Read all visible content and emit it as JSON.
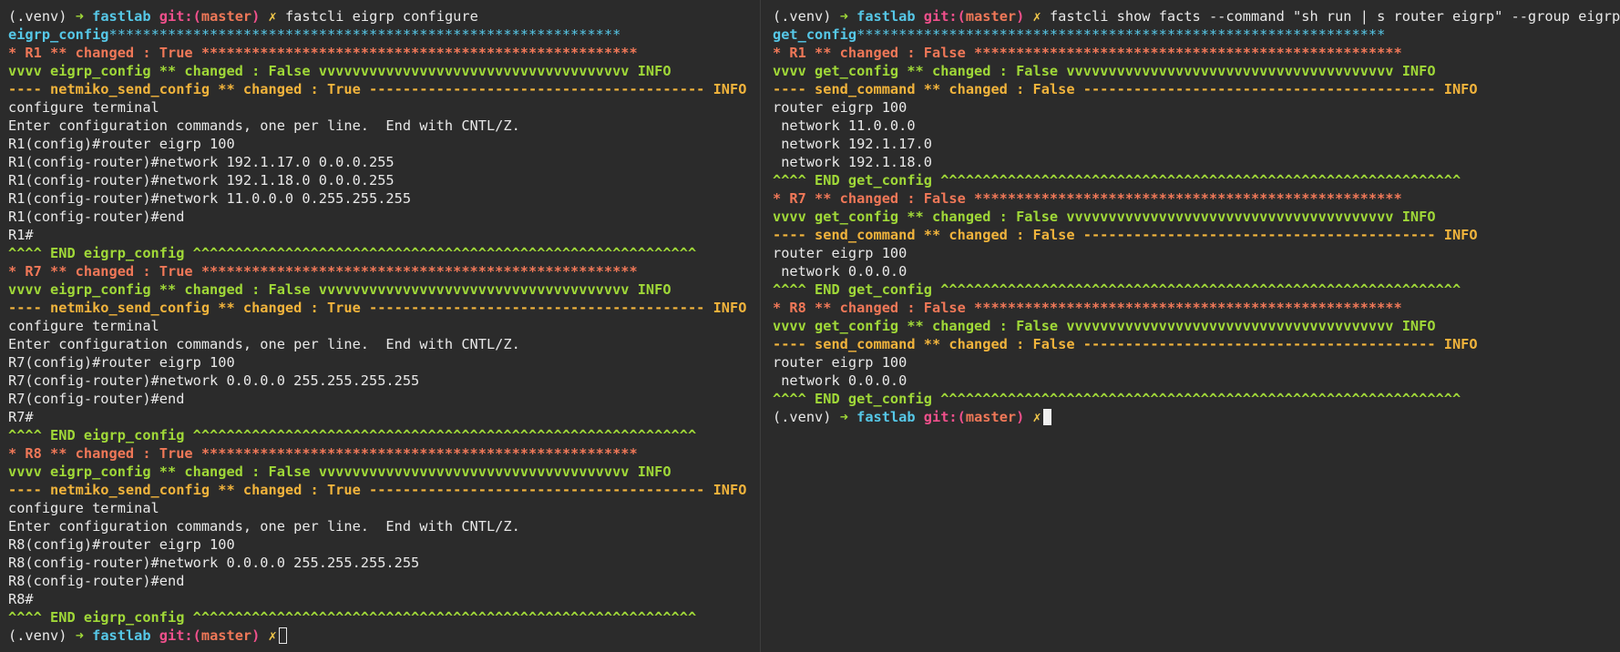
{
  "colors": {
    "background": "#2b2b2b",
    "text": "#e8e8e8",
    "cyan": "#56c8e8",
    "green": "#a0d838",
    "orange": "#f07858",
    "yellow": "#f2b43c",
    "pink": "#f0508c"
  },
  "panes": [
    {
      "name": "left-terminal",
      "lines": [
        [
          [
            "(.venv) ",
            "white"
          ],
          [
            "➜ ",
            "green"
          ],
          [
            "fastlab ",
            "cyan",
            "b"
          ],
          [
            "git:(",
            "pink",
            "b"
          ],
          [
            "master",
            "orange",
            "b"
          ],
          [
            ") ",
            "pink",
            "b"
          ],
          [
            "✗ ",
            "prompt-mark",
            "b"
          ],
          [
            "fastcli eigrp configure",
            "white"
          ]
        ],
        [
          [
            "eigrp_config",
            "cyan",
            "b"
          ],
          [
            "*************************************************************",
            "cyan"
          ]
        ],
        [
          [
            "* R1 ** changed : True ****************************************************",
            "orange",
            "b"
          ]
        ],
        [
          [
            "vvvv eigrp_config ** changed : False vvvvvvvvvvvvvvvvvvvvvvvvvvvvvvvvvvvvv INFO",
            "green",
            "b"
          ]
        ],
        [
          [
            "---- netmiko_send_config ** changed : True ---------------------------------------- INFO",
            "yellow",
            "b"
          ]
        ],
        [
          [
            "configure terminal",
            "white"
          ]
        ],
        [
          [
            "Enter configuration commands, one per line.  End with CNTL/Z.",
            "white"
          ]
        ],
        [
          [
            "R1(config)#router eigrp 100",
            "white"
          ]
        ],
        [
          [
            "R1(config-router)#network 192.1.17.0 0.0.0.255",
            "white"
          ]
        ],
        [
          [
            "R1(config-router)#network 192.1.18.0 0.0.0.255",
            "white"
          ]
        ],
        [
          [
            "R1(config-router)#network 11.0.0.0 0.255.255.255",
            "white"
          ]
        ],
        [
          [
            "R1(config-router)#end",
            "white"
          ]
        ],
        [
          [
            "R1#",
            "white"
          ]
        ],
        [
          [
            "^^^^ END eigrp_config ^^^^^^^^^^^^^^^^^^^^^^^^^^^^^^^^^^^^^^^^^^^^^^^^^^^^^^^^^^^^",
            "green",
            "b"
          ]
        ],
        [
          [
            "* R7 ** changed : True ****************************************************",
            "orange",
            "b"
          ]
        ],
        [
          [
            "vvvv eigrp_config ** changed : False vvvvvvvvvvvvvvvvvvvvvvvvvvvvvvvvvvvvv INFO",
            "green",
            "b"
          ]
        ],
        [
          [
            "---- netmiko_send_config ** changed : True ---------------------------------------- INFO",
            "yellow",
            "b"
          ]
        ],
        [
          [
            "configure terminal",
            "white"
          ]
        ],
        [
          [
            "Enter configuration commands, one per line.  End with CNTL/Z.",
            "white"
          ]
        ],
        [
          [
            "R7(config)#router eigrp 100",
            "white"
          ]
        ],
        [
          [
            "R7(config-router)#network 0.0.0.0 255.255.255.255",
            "white"
          ]
        ],
        [
          [
            "R7(config-router)#end",
            "white"
          ]
        ],
        [
          [
            "R7#",
            "white"
          ]
        ],
        [
          [
            "^^^^ END eigrp_config ^^^^^^^^^^^^^^^^^^^^^^^^^^^^^^^^^^^^^^^^^^^^^^^^^^^^^^^^^^^^",
            "green",
            "b"
          ]
        ],
        [
          [
            "* R8 ** changed : True ****************************************************",
            "orange",
            "b"
          ]
        ],
        [
          [
            "vvvv eigrp_config ** changed : False vvvvvvvvvvvvvvvvvvvvvvvvvvvvvvvvvvvvv INFO",
            "green",
            "b"
          ]
        ],
        [
          [
            "---- netmiko_send_config ** changed : True ---------------------------------------- INFO",
            "yellow",
            "b"
          ]
        ],
        [
          [
            "configure terminal",
            "white"
          ]
        ],
        [
          [
            "Enter configuration commands, one per line.  End with CNTL/Z.",
            "white"
          ]
        ],
        [
          [
            "R8(config)#router eigrp 100",
            "white"
          ]
        ],
        [
          [
            "R8(config-router)#network 0.0.0.0 255.255.255.255",
            "white"
          ]
        ],
        [
          [
            "R8(config-router)#end",
            "white"
          ]
        ],
        [
          [
            "R8#",
            "white"
          ]
        ],
        [
          [
            "^^^^ END eigrp_config ^^^^^^^^^^^^^^^^^^^^^^^^^^^^^^^^^^^^^^^^^^^^^^^^^^^^^^^^^^^^",
            "green",
            "b"
          ]
        ],
        [
          [
            "(.venv) ",
            "white"
          ],
          [
            "➜ ",
            "green"
          ],
          [
            "fastlab ",
            "cyan",
            "b"
          ],
          [
            "git:(",
            "pink",
            "b"
          ],
          [
            "master",
            "orange",
            "b"
          ],
          [
            ") ",
            "pink",
            "b"
          ],
          [
            "✗",
            "prompt-mark",
            "b"
          ]
        ]
      ],
      "cursor": "hollow"
    },
    {
      "name": "right-terminal",
      "lines": [
        [
          [
            "(.venv) ",
            "white"
          ],
          [
            "➜ ",
            "green"
          ],
          [
            "fastlab ",
            "cyan",
            "b"
          ],
          [
            "git:(",
            "pink",
            "b"
          ],
          [
            "master",
            "orange",
            "b"
          ],
          [
            ") ",
            "pink",
            "b"
          ],
          [
            "✗ ",
            "prompt-mark",
            "b"
          ],
          [
            "fastcli show facts --command \"sh run | s router eigrp\" --group eigrp",
            "white"
          ]
        ],
        [
          [
            "get_config",
            "cyan",
            "b"
          ],
          [
            "***************************************************************",
            "cyan"
          ]
        ],
        [
          [
            "* R1 ** changed : False ***************************************************",
            "orange",
            "b"
          ]
        ],
        [
          [
            "vvvv get_config ** changed : False vvvvvvvvvvvvvvvvvvvvvvvvvvvvvvvvvvvvvvv INFO",
            "green",
            "b"
          ]
        ],
        [
          [
            "---- send_command ** changed : False ------------------------------------------ INFO",
            "yellow",
            "b"
          ]
        ],
        [
          [
            "router eigrp 100",
            "white"
          ]
        ],
        [
          [
            " network 11.0.0.0",
            "white"
          ]
        ],
        [
          [
            " network 192.1.17.0",
            "white"
          ]
        ],
        [
          [
            " network 192.1.18.0",
            "white"
          ]
        ],
        [
          [
            "^^^^ END get_config ^^^^^^^^^^^^^^^^^^^^^^^^^^^^^^^^^^^^^^^^^^^^^^^^^^^^^^^^^^^^^^",
            "green",
            "b"
          ]
        ],
        [
          [
            "* R7 ** changed : False ***************************************************",
            "orange",
            "b"
          ]
        ],
        [
          [
            "vvvv get_config ** changed : False vvvvvvvvvvvvvvvvvvvvvvvvvvvvvvvvvvvvvvv INFO",
            "green",
            "b"
          ]
        ],
        [
          [
            "---- send_command ** changed : False ------------------------------------------ INFO",
            "yellow",
            "b"
          ]
        ],
        [
          [
            "router eigrp 100",
            "white"
          ]
        ],
        [
          [
            " network 0.0.0.0",
            "white"
          ]
        ],
        [
          [
            "^^^^ END get_config ^^^^^^^^^^^^^^^^^^^^^^^^^^^^^^^^^^^^^^^^^^^^^^^^^^^^^^^^^^^^^^",
            "green",
            "b"
          ]
        ],
        [
          [
            "* R8 ** changed : False ***************************************************",
            "orange",
            "b"
          ]
        ],
        [
          [
            "vvvv get_config ** changed : False vvvvvvvvvvvvvvvvvvvvvvvvvvvvvvvvvvvvvvv INFO",
            "green",
            "b"
          ]
        ],
        [
          [
            "---- send_command ** changed : False ------------------------------------------ INFO",
            "yellow",
            "b"
          ]
        ],
        [
          [
            "router eigrp 100",
            "white"
          ]
        ],
        [
          [
            " network 0.0.0.0",
            "white"
          ]
        ],
        [
          [
            "^^^^ END get_config ^^^^^^^^^^^^^^^^^^^^^^^^^^^^^^^^^^^^^^^^^^^^^^^^^^^^^^^^^^^^^^",
            "green",
            "b"
          ]
        ],
        [
          [
            "(.venv) ",
            "white"
          ],
          [
            "➜ ",
            "green"
          ],
          [
            "fastlab ",
            "cyan",
            "b"
          ],
          [
            "git:(",
            "pink",
            "b"
          ],
          [
            "master",
            "orange",
            "b"
          ],
          [
            ") ",
            "pink",
            "b"
          ],
          [
            "✗",
            "prompt-mark",
            "b"
          ]
        ]
      ],
      "cursor": "solid"
    }
  ]
}
